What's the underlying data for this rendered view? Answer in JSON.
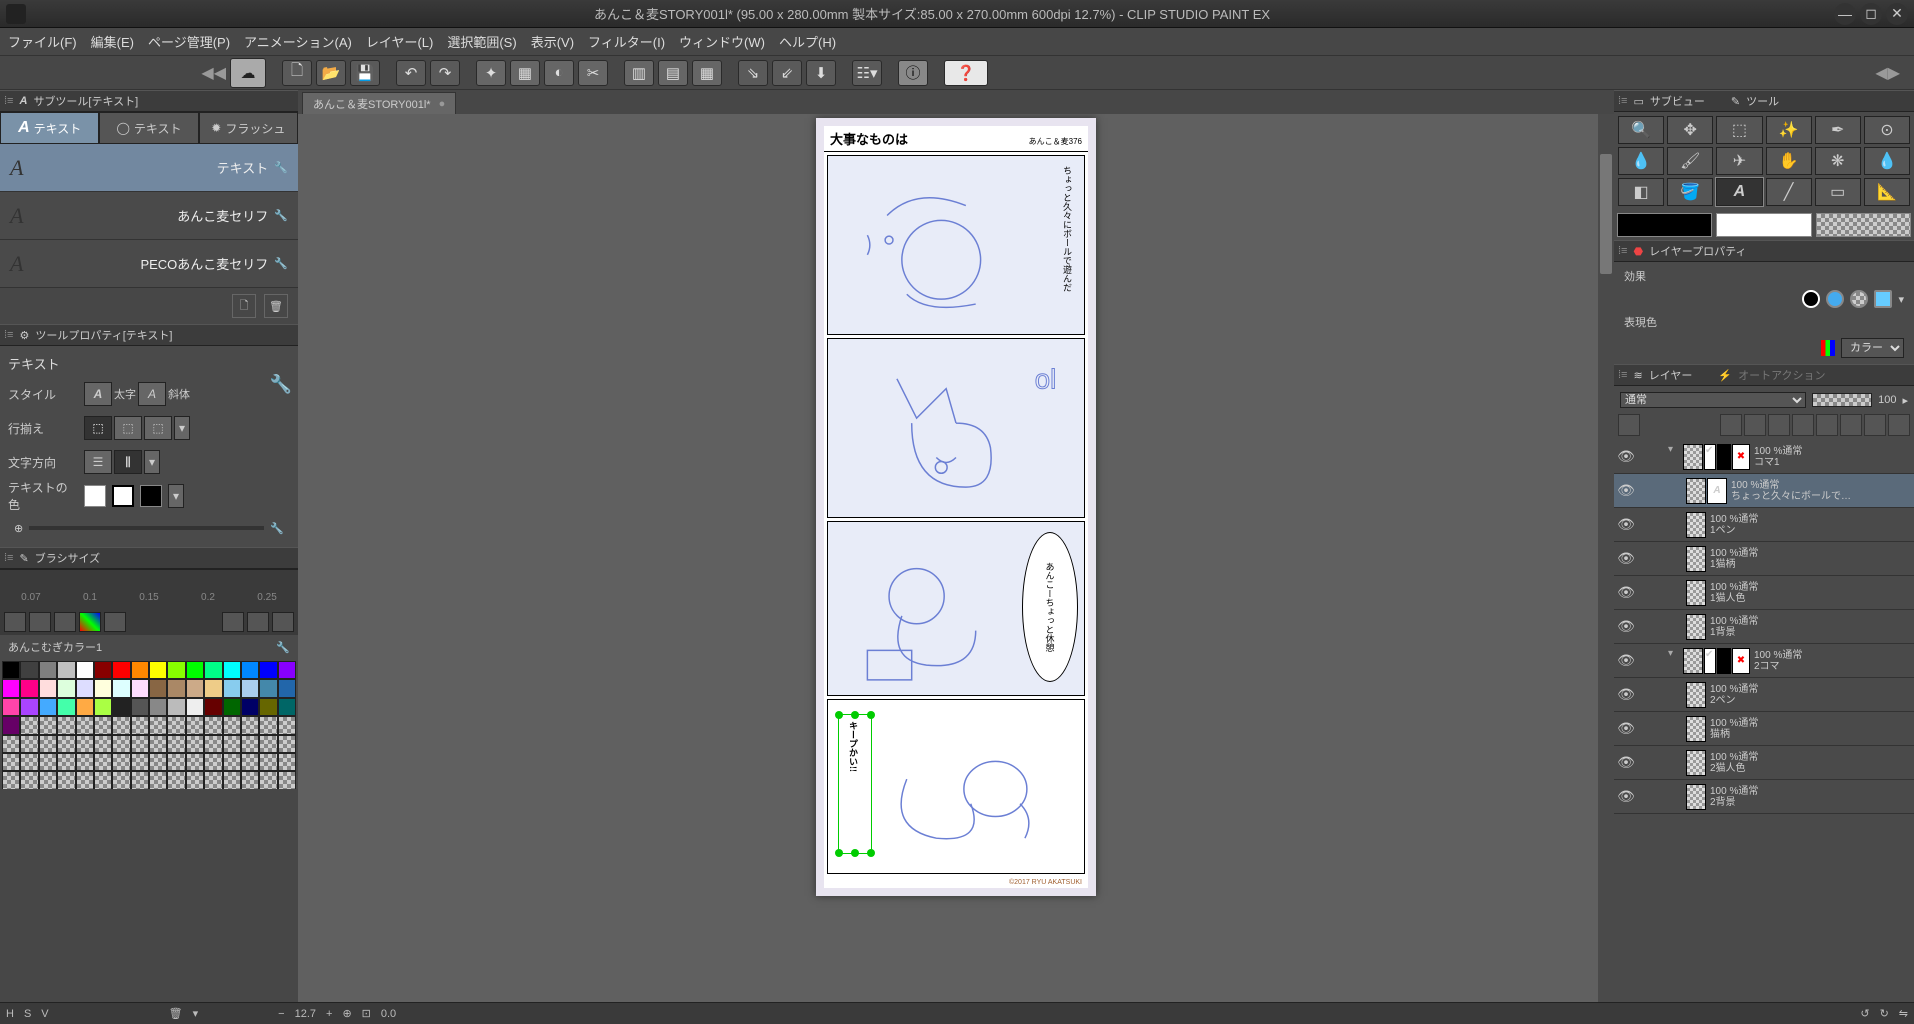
{
  "window": {
    "title": "あんこ＆麦STORY001l* (95.00 x 280.00mm 製本サイズ:85.00 x 270.00mm 600dpi 12.7%)  - CLIP STUDIO PAINT EX"
  },
  "menu": [
    "ファイル(F)",
    "編集(E)",
    "ページ管理(P)",
    "アニメーション(A)",
    "レイヤー(L)",
    "選択範囲(S)",
    "表示(V)",
    "フィルター(I)",
    "ウィンドウ(W)",
    "ヘルプ(H)"
  ],
  "doc_tab": {
    "label": "あんこ＆麦STORY001l*"
  },
  "subtool": {
    "header": "サブツール[テキスト]",
    "tabs": [
      "テキスト",
      "テキスト",
      "フラッシュ"
    ],
    "items": [
      "テキスト",
      "あんこ麦セリフ",
      "PECOあんこ麦セリフ"
    ]
  },
  "toolprop": {
    "header": "ツールプロパティ[テキスト]",
    "title": "テキスト",
    "rows": {
      "style": "スタイル",
      "style_opts": [
        "太字",
        "斜体"
      ],
      "align": "行揃え",
      "direction": "文字方向",
      "color": "テキストの色"
    }
  },
  "brush": {
    "header": "ブラシサイズ",
    "ticks": [
      "0.07",
      "0.1",
      "0.15",
      "0.2",
      "0.25"
    ]
  },
  "colorset": {
    "name": "あんこむぎカラー1"
  },
  "comic": {
    "title": "大事なものは",
    "subtitle": "あんこ＆麦376",
    "p1_text": "ちょっと久々にボールで遊んだ",
    "p3_text": "あんこーちょっと休憩",
    "p4_text": "キープかい!!",
    "copyright": "©2017 RYU AKATSUKI"
  },
  "right": {
    "subview": "サブビュー",
    "tool": "ツール",
    "layerprop": "レイヤープロパティ",
    "effect": "効果",
    "expression": "表現色",
    "color_mode": "カラー",
    "layer_hdr": "レイヤー",
    "autoaction": "オートアクション",
    "blend": "通常",
    "opacity": "100"
  },
  "layers": [
    {
      "type": "folder",
      "name": "コマ1",
      "opacity": "100 %通常",
      "indent": 1,
      "sel": false,
      "open": true,
      "red": true
    },
    {
      "type": "text",
      "name": "ちょっと久々にボールで…",
      "opacity": "100 %通常",
      "indent": 2,
      "sel": true
    },
    {
      "type": "layer",
      "name": "1ペン",
      "opacity": "100 %通常",
      "indent": 2
    },
    {
      "type": "layer",
      "name": "1猫柄",
      "opacity": "100 %通常",
      "indent": 2
    },
    {
      "type": "layer",
      "name": "1猫人色",
      "opacity": "100 %通常",
      "indent": 2
    },
    {
      "type": "layer",
      "name": "1背景",
      "opacity": "100 %通常",
      "indent": 2
    },
    {
      "type": "folder",
      "name": "2コマ",
      "opacity": "100 %通常",
      "indent": 1,
      "open": true,
      "red": true
    },
    {
      "type": "layer",
      "name": "2ペン",
      "opacity": "100 %通常",
      "indent": 2
    },
    {
      "type": "layer",
      "name": "猫柄",
      "opacity": "100 %通常",
      "indent": 2
    },
    {
      "type": "layer",
      "name": "2猫人色",
      "opacity": "100 %通常",
      "indent": 2
    },
    {
      "type": "layer",
      "name": "2背景",
      "opacity": "100 %通常",
      "indent": 2
    }
  ],
  "status": {
    "zoom": "12.7",
    "angle": "0.0",
    "H": "H",
    "S": "S",
    "V": "V"
  },
  "palette_colors": [
    "#000",
    "#404040",
    "#808080",
    "#c0c0c0",
    "#fff",
    "#800",
    "#f00",
    "#f80",
    "#ff0",
    "#8f0",
    "#0f0",
    "#0f8",
    "#0ff",
    "#08f",
    "#00f",
    "#80f",
    "#f0f",
    "#f08",
    "#fdd",
    "#dfd",
    "#ddf",
    "#ffd",
    "#dff",
    "#fdf",
    "#864",
    "#a86",
    "#ca8",
    "#ec8",
    "#8ce",
    "#ace",
    "#48a",
    "#26a",
    "#f4a",
    "#a4f",
    "#4af",
    "#4fa",
    "#fa4",
    "#af4",
    "#222",
    "#555",
    "#888",
    "#bbb",
    "#eee",
    "#600",
    "#060",
    "#006",
    "#660",
    "#066",
    "#606"
  ]
}
